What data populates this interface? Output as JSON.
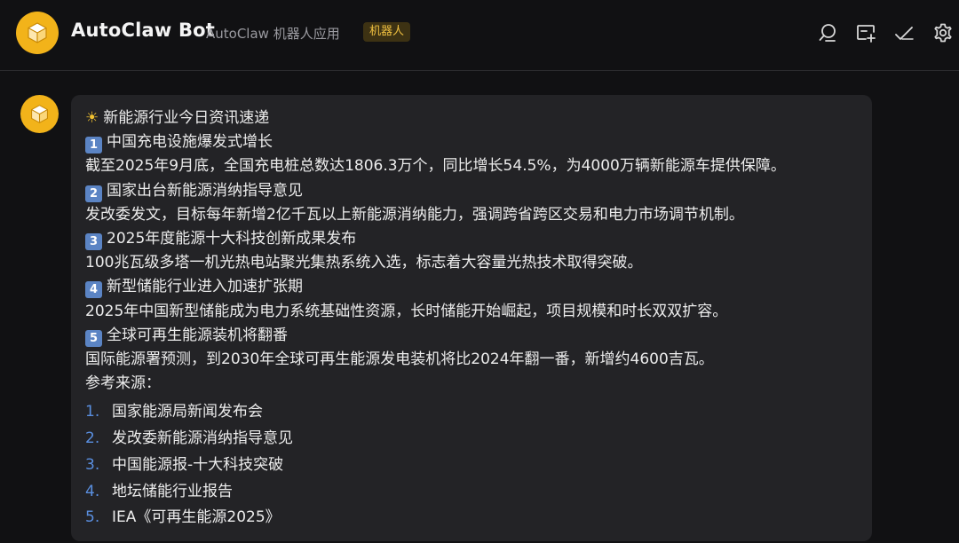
{
  "header": {
    "app_name": "AutoClaw Bot",
    "subtitle": "AutoClaw 机器人应用",
    "badge": "机器人",
    "icons": [
      "search-icon",
      "add-chat-icon",
      "check-icon",
      "settings-icon"
    ]
  },
  "colors": {
    "background": "#111113",
    "bubble": "#232326",
    "avatar": "#f2b31a",
    "badge_text": "#f0c040",
    "badge_bg": "#3d3213",
    "list_number": "#5a8fe0",
    "keycap": "#5b84c4"
  },
  "message": {
    "headline_icon": "sun-icon",
    "headline": "新能源行业今日资讯速递",
    "items": [
      {
        "number": "1",
        "title": "中国充电设施爆发式增长",
        "body": "截至2025年9月底，全国充电桩总数达1806.3万个，同比增长54.5%，为4000万辆新能源车提供保障。"
      },
      {
        "number": "2",
        "title": "国家出台新能源消纳指导意见",
        "body": "发改委发文，目标每年新增2亿千瓦以上新能源消纳能力，强调跨省跨区交易和电力市场调节机制。"
      },
      {
        "number": "3",
        "title": "2025年度能源十大科技创新成果发布",
        "body": "100兆瓦级多塔一机光热电站聚光集热系统入选，标志着大容量光热技术取得突破。"
      },
      {
        "number": "4",
        "title": "新型储能行业进入加速扩张期",
        "body": "2025年中国新型储能成为电力系统基础性资源，长时储能开始崛起，项目规模和时长双双扩容。"
      },
      {
        "number": "5",
        "title": "全球可再生能源装机将翻番",
        "body": "国际能源署预测，到2030年全球可再生能源发电装机将比2024年翻一番，新增约4600吉瓦。"
      }
    ],
    "refs_label": "参考来源：",
    "refs": [
      {
        "num": "1.",
        "text": "国家能源局新闻发布会"
      },
      {
        "num": "2.",
        "text": "发改委新能源消纳指导意见"
      },
      {
        "num": "3.",
        "text": "中国能源报-十大科技突破"
      },
      {
        "num": "4.",
        "text": "地坛储能行业报告"
      },
      {
        "num": "5.",
        "text": "IEA《可再生能源2025》"
      }
    ]
  }
}
